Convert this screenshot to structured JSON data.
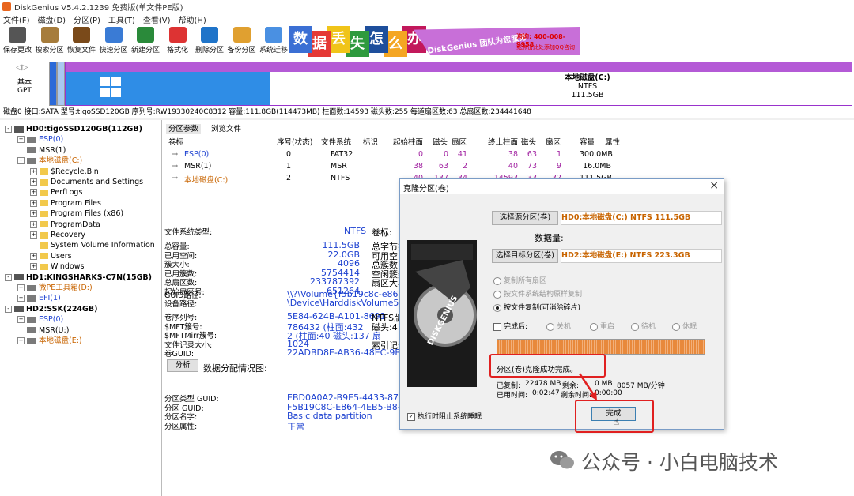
{
  "window": {
    "title": "DiskGenius V5.4.2.1239 免费版(单文件PE版)"
  },
  "menu": [
    "文件(F)",
    "磁盘(D)",
    "分区(P)",
    "工具(T)",
    "查看(V)",
    "帮助(H)"
  ],
  "toolbar": [
    {
      "label": "保存更改",
      "icon": "save-icon",
      "color": "#555"
    },
    {
      "label": "搜索分区",
      "icon": "magnifier-icon",
      "color": "#a67c3b"
    },
    {
      "label": "恢复文件",
      "icon": "recover-icon",
      "color": "#7a4a1a"
    },
    {
      "label": "快速分区",
      "icon": "quick-partition-icon",
      "color": "#3a7bd5"
    },
    {
      "label": "新建分区",
      "icon": "new-partition-icon",
      "color": "#2a8a3a"
    },
    {
      "label": "格式化",
      "icon": "format-icon",
      "color": "#d33"
    },
    {
      "label": "删除分区",
      "icon": "delete-icon",
      "color": "#1f74c9"
    },
    {
      "label": "备份分区",
      "icon": "backup-icon",
      "color": "#e0a030"
    },
    {
      "label": "系统迁移",
      "icon": "migrate-icon",
      "color": "#4a90e2"
    }
  ],
  "banner": {
    "chars": [
      {
        "c": "数",
        "bg": "#3b6fd4"
      },
      {
        "c": "据",
        "bg": "#e53935"
      },
      {
        "c": "丢",
        "bg": "#f0c419"
      },
      {
        "c": "失",
        "bg": "#2e9a3e"
      },
      {
        "c": "怎",
        "bg": "#1e4f9c"
      },
      {
        "c": "么",
        "bg": "#f4a623"
      },
      {
        "c": "办",
        "bg": "#c2185b"
      }
    ],
    "slogan": "DiskGenius 团队为您服务",
    "phone": "咨询: 400-008-9958",
    "qq": "或点击此处添加QQ咨询"
  },
  "diskbar": {
    "style_top": "基本",
    "style_bottom": "GPT",
    "partition_name": "本地磁盘(C:)",
    "fs": "NTFS",
    "size": "111.5GB"
  },
  "disk_info": "磁盘0 接口:SATA  型号:tigoSSD120GB  序列号:RW19330240C8312  容量:111.8GB(114473MB)  柱面数:14593  磁头数:255  每道扇区数:63  总扇区数:234441648",
  "tree": [
    {
      "label": "HD0:tigoSSD120GB(112GB)",
      "level": 0,
      "type": "disk",
      "color": "#000",
      "bold": true,
      "pm": "-"
    },
    {
      "label": "ESP(0)",
      "level": 1,
      "type": "part",
      "color": "#1a3fd0",
      "pm": "+"
    },
    {
      "label": "MSR(1)",
      "level": 1,
      "type": "part",
      "color": "#000",
      "pm": ""
    },
    {
      "label": "本地磁盘(C:)",
      "level": 1,
      "type": "part",
      "color": "#c86400",
      "pm": "-"
    },
    {
      "label": "$Recycle.Bin",
      "level": 2,
      "type": "folder",
      "color": "#000",
      "pm": "+"
    },
    {
      "label": "Documents and Settings",
      "level": 2,
      "type": "folder",
      "color": "#000",
      "pm": "+"
    },
    {
      "label": "PerfLogs",
      "level": 2,
      "type": "folder",
      "color": "#000",
      "pm": "+"
    },
    {
      "label": "Program Files",
      "level": 2,
      "type": "folder",
      "color": "#000",
      "pm": "+"
    },
    {
      "label": "Program Files (x86)",
      "level": 2,
      "type": "folder",
      "color": "#000",
      "pm": "+"
    },
    {
      "label": "ProgramData",
      "level": 2,
      "type": "folder",
      "color": "#000",
      "pm": "+"
    },
    {
      "label": "Recovery",
      "level": 2,
      "type": "folder",
      "color": "#000",
      "pm": "+"
    },
    {
      "label": "System Volume Information",
      "level": 2,
      "type": "folder",
      "color": "#000",
      "pm": ""
    },
    {
      "label": "Users",
      "level": 2,
      "type": "folder",
      "color": "#000",
      "pm": "+"
    },
    {
      "label": "Windows",
      "level": 2,
      "type": "folder",
      "color": "#000",
      "pm": "+"
    },
    {
      "label": "HD1:KINGSHARKS-C7N(15GB)",
      "level": 0,
      "type": "disk",
      "color": "#000",
      "bold": true,
      "pm": "-"
    },
    {
      "label": "微PE工具箱(D:)",
      "level": 1,
      "type": "part",
      "color": "#c86400",
      "pm": "+"
    },
    {
      "label": "EFI(1)",
      "level": 1,
      "type": "part",
      "color": "#1a3fd0",
      "pm": "+"
    },
    {
      "label": "HD2:SSK(224GB)",
      "level": 0,
      "type": "disk",
      "color": "#000",
      "bold": true,
      "pm": "-"
    },
    {
      "label": "ESP(0)",
      "level": 1,
      "type": "part",
      "color": "#1a3fd0",
      "pm": "+"
    },
    {
      "label": "MSR(U:)",
      "level": 1,
      "type": "part",
      "color": "#000",
      "pm": ""
    },
    {
      "label": "本地磁盘(E:)",
      "level": 1,
      "type": "part",
      "color": "#c86400",
      "pm": "+"
    }
  ],
  "tabs": [
    "分区参数",
    "浏览文件"
  ],
  "partition_table": {
    "headers": [
      "卷标",
      "序号(状态)",
      "文件系统",
      "标识",
      "起始柱面",
      "磁头",
      "扇区",
      "终止柱面",
      "磁头",
      "扇区",
      "容量",
      "属性"
    ],
    "rows": [
      {
        "cells": [
          "ESP(0)",
          "0",
          "FAT32",
          "",
          "0",
          "0",
          "41",
          "38",
          "63",
          "1",
          "300.0MB",
          ""
        ],
        "color": "#1a3fd0"
      },
      {
        "cells": [
          "MSR(1)",
          "1",
          "MSR",
          "",
          "38",
          "63",
          "2",
          "40",
          "73",
          "9",
          "16.0MB",
          ""
        ],
        "color": "#000"
      },
      {
        "cells": [
          "本地磁盘(C:)",
          "2",
          "NTFS",
          "",
          "40",
          "137",
          "34",
          "14593",
          "33",
          "32",
          "111.5GB",
          ""
        ],
        "color": "#c86400"
      }
    ]
  },
  "fs_info": {
    "fs_type_label": "文件系统类型:",
    "fs_type": "NTFS",
    "vol_label_label": "卷标:",
    "rows": [
      {
        "l": "总容量:",
        "v": "111.5GB",
        "r": "总字节数"
      },
      {
        "l": "已用空间:",
        "v": "22.0GB",
        "r": "可用空间"
      },
      {
        "l": "簇大小:",
        "v": "4096",
        "r": "总簇数:"
      },
      {
        "l": "已用簇数:",
        "v": "5754414",
        "r": "空闲簇数"
      },
      {
        "l": "总扇区数:",
        "v": "233787392",
        "r": "扇区大小"
      },
      {
        "l": "起始扇区号:",
        "v": "651264",
        "r": ""
      }
    ],
    "guid_path_label": "GUID路径:",
    "guid_path": "\\\\?\\Volume{f5b19c8c-e864-4eb5-",
    "device_path_label": "设备路径:",
    "device_path": "\\Device\\HarddiskVolume5",
    "rows2": [
      {
        "l": "卷序列号:",
        "v": "5E84-624B-A101-8691",
        "r": "NTFS版本"
      },
      {
        "l": "$MFT簇号:",
        "v": "786432 (柱面:432",
        "r": "磁头:41 扇"
      },
      {
        "l": "$MFTMirr簇号:",
        "v": "2 (柱面:40 磁头:137 扇",
        "r": ""
      },
      {
        "l": "文件记录大小:",
        "v": "1024",
        "r": "索引记录"
      },
      {
        "l": "卷GUID:",
        "v": "22ADBD8E-AB36-48EC-9BDA-3C4",
        "r": ""
      }
    ],
    "analyze_btn": "分析",
    "dist_label": "数据分配情况图:",
    "rows3": [
      {
        "l": "分区类型 GUID:",
        "v": "EBD0A0A2-B9E5-4433-87C0-68B6"
      },
      {
        "l": "分区 GUID:",
        "v": "F5B19C8C-E864-4EB5-B84A-B3E7"
      },
      {
        "l": "分区名字:",
        "v": "Basic data partition"
      },
      {
        "l": "分区属性:",
        "v": "正常"
      }
    ]
  },
  "dialog": {
    "title": "克隆分区(卷)",
    "select_source": "选择源分区(卷)",
    "source_value": "HD0:本地磁盘(C:) NTFS 111.5GB",
    "data_amount": "数据量:",
    "select_target": "选择目标分区(卷)",
    "target_value": "HD2:本地磁盘(E:) NTFS 223.3GB",
    "options": [
      "复制所有扇区",
      "按文件系统结构原样复制",
      "按文件复制(可消除碎片)"
    ],
    "after_label": "完成后:",
    "after_options": [
      "关机",
      "重启",
      "待机",
      "休眠"
    ],
    "progress": 1.0,
    "status": "分区(卷)克隆成功完成。",
    "copied_label": "已复制:",
    "copied": "22478 MB",
    "remain_label": "剩余:",
    "remain": "0 MB",
    "speed": "8057 MB/分钟",
    "elapsed_label": "已用时间:",
    "elapsed": "0:02:47",
    "remain_time_label": "剩余时间:",
    "remain_time": "0:00:00",
    "prevent_sleep": "执行时阻止系统睡眠",
    "finish": "完成",
    "hdd_brand": "DISKGENIUS"
  },
  "watermark": "公众号 · 小白电脑技术"
}
